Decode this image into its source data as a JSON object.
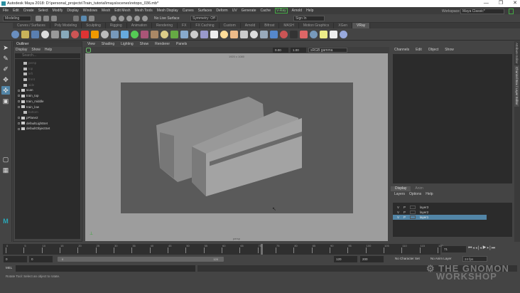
{
  "window": {
    "title": "Autodesk Maya 2018: D:\\personal_projects\\Train_tutorial\\maya\\scenes\\retopo_036.mb*",
    "controls": [
      "—",
      "❐",
      "✕"
    ]
  },
  "menubar": [
    "File",
    "Edit",
    "Create",
    "Select",
    "Modify",
    "Display",
    "Windows",
    "Mesh",
    "Edit Mesh",
    "Mesh Tools",
    "Mesh Display",
    "Curves",
    "Surfaces",
    "Deform",
    "UV",
    "Generate",
    "Cache",
    "V-Ray",
    "Arnold",
    "Help"
  ],
  "status": {
    "mode": "Modeling",
    "live_surface": "No Live Surface",
    "symmetry": "Symmetry: Off",
    "sign_in": "Sign In",
    "workspace_label": "Workspace :",
    "workspace": "Maya Classic*"
  },
  "shelf_tabs": [
    "Curves / Surfaces",
    "Poly Modeling",
    "Sculpting",
    "Rigging",
    "Animation",
    "Rendering",
    "FX",
    "FX Caching",
    "Custom",
    "Arnold",
    "Bifrost",
    "MASH",
    "Motion Graphics",
    "XGen",
    "VRay"
  ],
  "shelf_active": "VRay",
  "outliner": {
    "title": "Outliner",
    "menu": [
      "Display",
      "Show",
      "Help"
    ],
    "search_placeholder": "Search...",
    "items": [
      {
        "name": "persp",
        "dim": true
      },
      {
        "name": "top",
        "dim": true
      },
      {
        "name": "left",
        "dim": true
      },
      {
        "name": "front",
        "dim": true
      },
      {
        "name": "side",
        "dim": true
      },
      {
        "name": "scan",
        "dim": false
      },
      {
        "name": "train_top",
        "dim": false
      },
      {
        "name": "train_middle",
        "dim": false
      },
      {
        "name": "train_low",
        "dim": false
      },
      {
        "name": "bottom",
        "dim": true
      },
      {
        "name": "pPlane2",
        "dim": false
      },
      {
        "name": "defaultLightSet",
        "dim": false
      },
      {
        "name": "defaultObjectSet",
        "dim": false
      }
    ]
  },
  "viewport": {
    "menu": [
      "View",
      "Shading",
      "Lighting",
      "Show",
      "Renderer",
      "Panels"
    ],
    "resolution": "1920 x 1080",
    "exposure": "0.00",
    "gamma": "1.00",
    "color_space": "sRGB gamma",
    "camera": "persp"
  },
  "channel_box": {
    "menu": [
      "Channels",
      "Edit",
      "Object",
      "Show"
    ],
    "side_tabs": [
      "Attribute Editor",
      "Channel Box / Layer Editor"
    ]
  },
  "layer_editor": {
    "tabs": [
      "Display",
      "Anim"
    ],
    "menu": [
      "Layers",
      "Options",
      "Help"
    ],
    "layers": [
      {
        "v": "V",
        "p": "P",
        "name": "layer3"
      },
      {
        "v": "V",
        "p": "P",
        "name": "layer2"
      },
      {
        "v": "V",
        "p": "P",
        "name": "layer1",
        "selected": true
      }
    ]
  },
  "timeline": {
    "ticks": [
      "0",
      "5",
      "10",
      "15",
      "20",
      "25",
      "30",
      "35",
      "40",
      "45",
      "50",
      "55",
      "60",
      "65",
      "70",
      "75",
      "80",
      "85",
      "90",
      "95",
      "100",
      "105",
      "110",
      "115",
      "120"
    ],
    "current_frame": "71",
    "range_start": "0",
    "playback_start": "0",
    "slider_start": "0",
    "slider_end": "120",
    "playback_end": "120",
    "range_end": "200",
    "character_set": "No Character Set",
    "anim_layer": "No Anim Layer",
    "fps": "24 fps"
  },
  "command_line": {
    "label": "MEL"
  },
  "help_line": "Rotate Tool: Select an object to rotate.",
  "watermark": {
    "line1": "THE GNOMON",
    "line2": "WORKSHOP"
  }
}
